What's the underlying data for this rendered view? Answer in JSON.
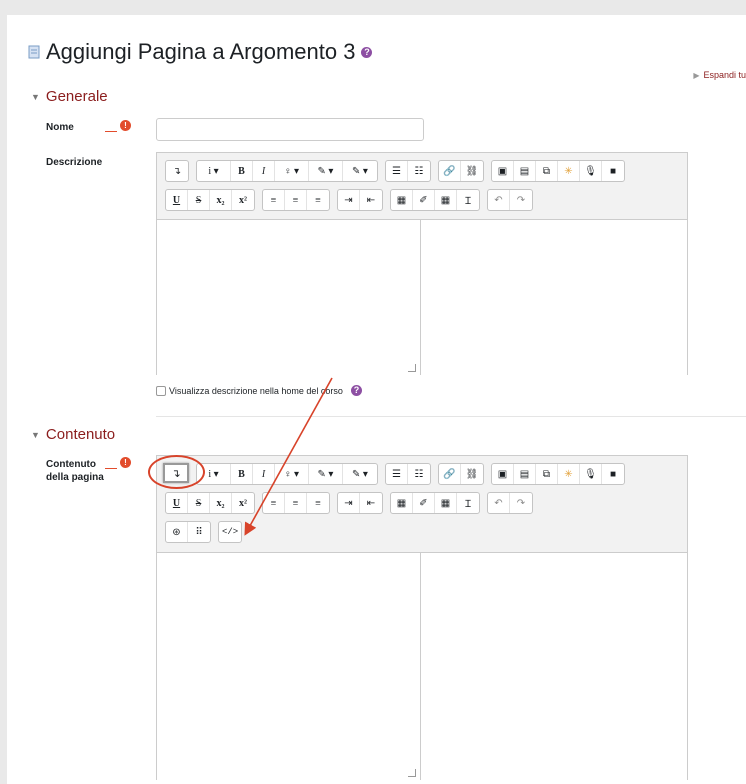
{
  "page": {
    "title": "Aggiungi Pagina a Argomento 3",
    "expand_all": "Espandi tu"
  },
  "sections": {
    "general": {
      "title": "Generale",
      "name_label": "Nome",
      "name_value": "",
      "description_label": "Descrizione",
      "show_desc_label": "Visualizza descrizione nella home del corso"
    },
    "content": {
      "title": "Contenuto",
      "content_label_line1": "Contenuto",
      "content_label_line2": "della pagina"
    }
  },
  "toolbar": {
    "collapse": "↴",
    "info": "i ▾",
    "bold": "B",
    "italic": "I",
    "bulb": "♀ ▾",
    "brush1": "✎ ▾",
    "brush2": "✎ ▾",
    "ul": "☰",
    "ol": "☷",
    "link": "🔗",
    "unlink": "⛓",
    "image": "▣",
    "media": "▤",
    "copy": "⧉",
    "star": "✳",
    "mic": "🎙",
    "video": "■",
    "underline": "U",
    "strike": "S",
    "sub": "x₂",
    "sup": "x²",
    "align_left": "≡",
    "align_center": "≡",
    "align_right": "≡",
    "indent": "⇥",
    "outdent": "⇤",
    "calc": "▦",
    "edit": "✐",
    "table": "▦",
    "clear": "Ɪ",
    "undo": "↶",
    "redo": "↷",
    "accessibility": "⊛",
    "braille": "⠿",
    "html": "</>"
  },
  "colors": {
    "accent": "#8b1d1d",
    "required": "#e24c2c",
    "help": "#8d4fa3",
    "annotation": "#d8432a"
  }
}
